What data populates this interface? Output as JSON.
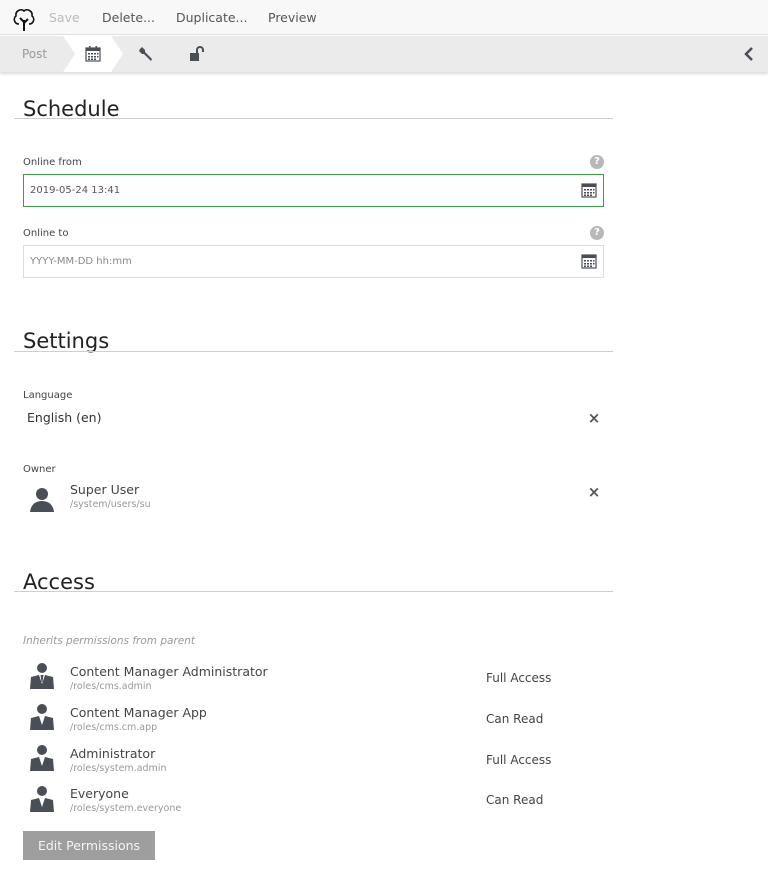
{
  "toolbar": {
    "logo": "tree-logo-icon",
    "save_label": "Save",
    "delete_label": "Delete...",
    "duplicate_label": "Duplicate...",
    "preview_label": "Preview"
  },
  "subbar": {
    "post_label": "Post",
    "tabs": [
      {
        "icon": "calendar-icon",
        "active": true
      },
      {
        "icon": "wrench-icon",
        "active": false
      },
      {
        "icon": "unlock-icon",
        "active": false
      }
    ],
    "collapse_icon": "chevron-left-icon"
  },
  "schedule": {
    "title": "Schedule",
    "online_from": {
      "label": "Online from",
      "value": "2019-05-24 13:41",
      "placeholder": "YYYY-MM-DD hh:mm",
      "help": "?"
    },
    "online_to": {
      "label": "Online to",
      "value": "",
      "placeholder": "YYYY-MM-DD hh:mm",
      "help": "?"
    }
  },
  "settings": {
    "title": "Settings",
    "language": {
      "label": "Language",
      "value": "English (en)",
      "clear": "×"
    },
    "owner": {
      "label": "Owner",
      "name": "Super User",
      "path": "/system/users/su",
      "clear": "×"
    }
  },
  "access": {
    "title": "Access",
    "inherit_note": "Inherits permissions from parent",
    "roles": [
      {
        "name": "Content Manager Administrator",
        "path": "/roles/cms.admin",
        "permission": "Full Access"
      },
      {
        "name": "Content Manager App",
        "path": "/roles/cms.cm.app",
        "permission": "Can Read"
      },
      {
        "name": "Administrator",
        "path": "/roles/system.admin",
        "permission": "Full Access"
      },
      {
        "name": "Everyone",
        "path": "/roles/system.everyone",
        "permission": "Can Read"
      }
    ],
    "edit_button": "Edit Permissions"
  },
  "colors": {
    "focus_border": "#3c9a4c",
    "button_bg": "#9e9e9e",
    "icon_dark": "#4a4e57"
  }
}
